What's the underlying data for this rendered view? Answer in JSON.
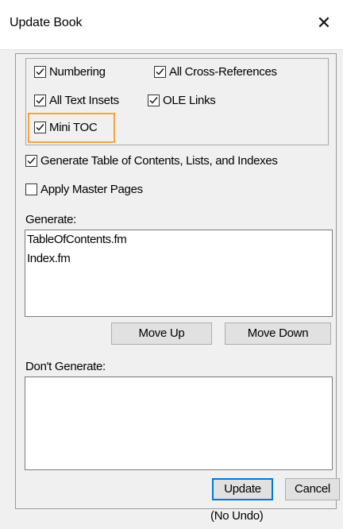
{
  "window": {
    "title": "Update Book",
    "close_glyph": "✕"
  },
  "update_options": {
    "numbering": {
      "label": "Numbering",
      "checked": true
    },
    "all_cross_references": {
      "label": "All Cross-References",
      "checked": true
    },
    "all_text_insets": {
      "label": "All Text Insets",
      "checked": true
    },
    "ole_links": {
      "label": "OLE Links",
      "checked": true
    },
    "mini_toc": {
      "label": "Mini TOC",
      "checked": true
    }
  },
  "generate_toc": {
    "label": "Generate Table of Contents, Lists, and Indexes",
    "checked": true
  },
  "apply_master_pages": {
    "label": "Apply Master Pages",
    "checked": false
  },
  "generate": {
    "label": "Generate:",
    "items": [
      "TableOfContents.fm",
      "Index.fm"
    ]
  },
  "buttons": {
    "move_up": "Move Up",
    "move_down": "Move Down",
    "update": "Update",
    "cancel": "Cancel"
  },
  "dont_generate": {
    "label": "Don't Generate:",
    "items": []
  },
  "no_undo": "(No Undo)",
  "colors": {
    "highlight": "#f4a543",
    "default_button_border": "#0078d7"
  }
}
